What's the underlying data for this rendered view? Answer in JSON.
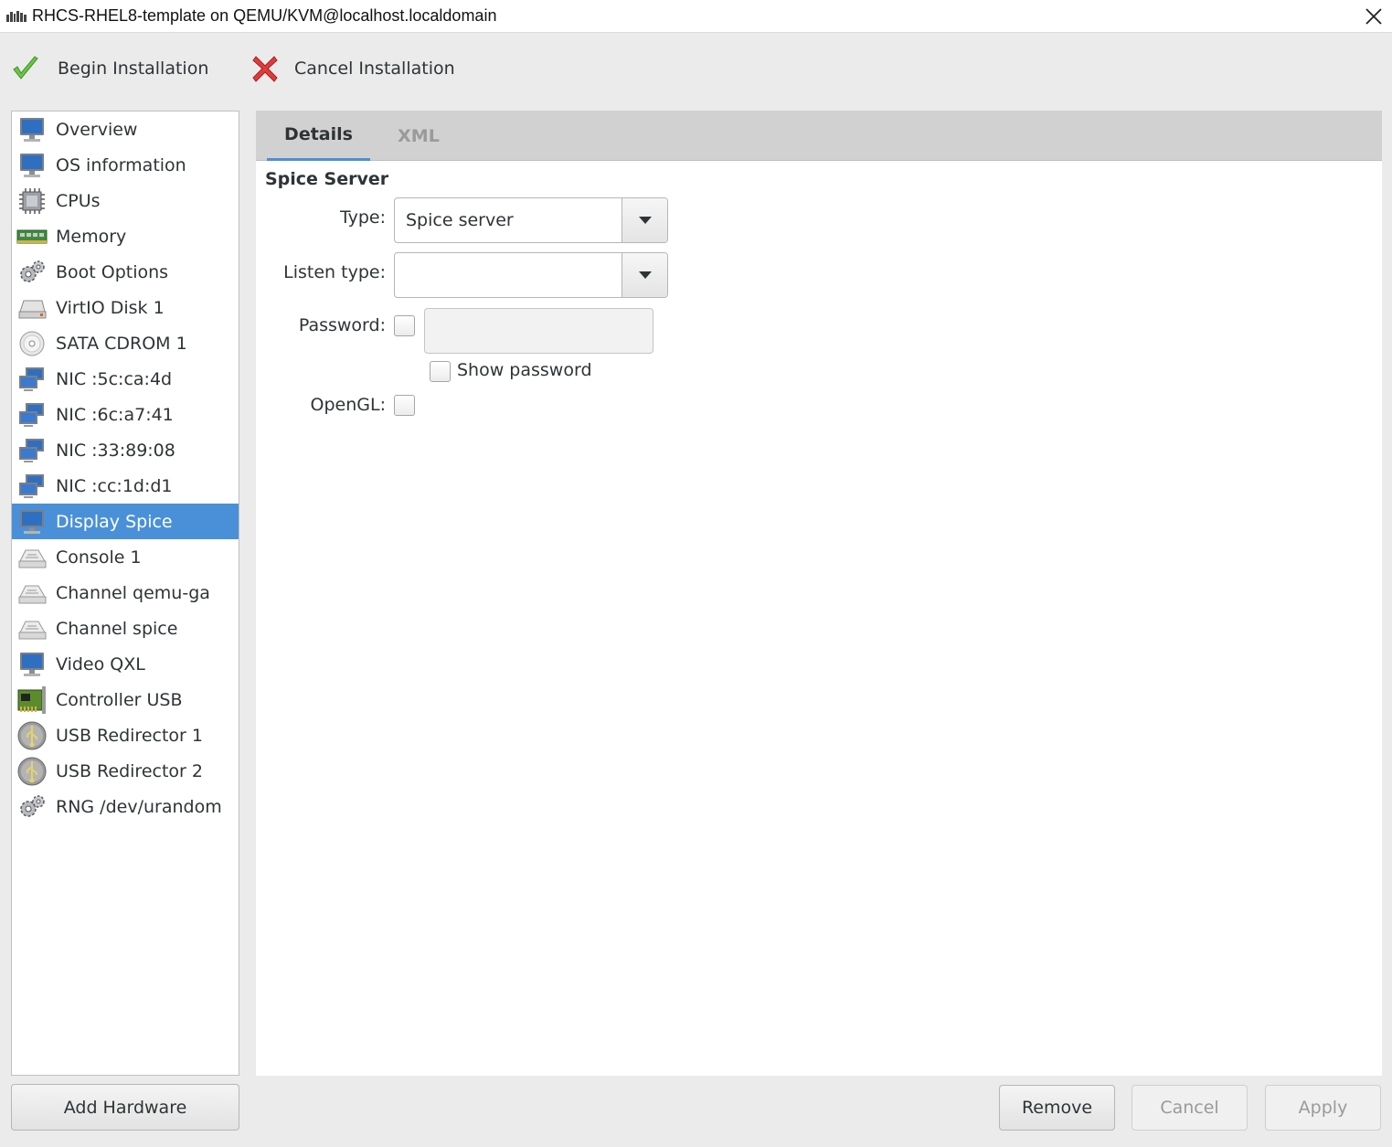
{
  "window": {
    "title": "RHCS-RHEL8-template on QEMU/KVM@localhost.localdomain"
  },
  "toolbar": {
    "begin_label": "Begin Installation",
    "cancel_label": "Cancel Installation"
  },
  "sidebar": {
    "selected_index": 11,
    "items": [
      {
        "label": "Overview",
        "icon": "monitor-icon"
      },
      {
        "label": "OS information",
        "icon": "monitor-icon"
      },
      {
        "label": "CPUs",
        "icon": "cpu-icon"
      },
      {
        "label": "Memory",
        "icon": "memory-icon"
      },
      {
        "label": "Boot Options",
        "icon": "gears-icon"
      },
      {
        "label": "VirtIO Disk 1",
        "icon": "disk-icon"
      },
      {
        "label": "SATA CDROM 1",
        "icon": "cdrom-icon"
      },
      {
        "label": "NIC :5c:ca:4d",
        "icon": "network-icon"
      },
      {
        "label": "NIC :6c:a7:41",
        "icon": "network-icon"
      },
      {
        "label": "NIC :33:89:08",
        "icon": "network-icon"
      },
      {
        "label": "NIC :cc:1d:d1",
        "icon": "network-icon"
      },
      {
        "label": "Display Spice",
        "icon": "monitor-icon"
      },
      {
        "label": "Console 1",
        "icon": "serial-icon"
      },
      {
        "label": "Channel qemu-ga",
        "icon": "serial-icon"
      },
      {
        "label": "Channel spice",
        "icon": "serial-icon"
      },
      {
        "label": "Video QXL",
        "icon": "monitor-icon"
      },
      {
        "label": "Controller USB",
        "icon": "controller-icon"
      },
      {
        "label": "USB Redirector 1",
        "icon": "usb-icon"
      },
      {
        "label": "USB Redirector 2",
        "icon": "usb-icon"
      },
      {
        "label": "RNG /dev/urandom",
        "icon": "gears-icon"
      }
    ],
    "add_hardware_label": "Add Hardware"
  },
  "tabs": {
    "details": "Details",
    "xml": "XML"
  },
  "spice": {
    "section_title": "Spice Server",
    "type_label": "Type:",
    "type_value": "Spice server",
    "listen_label": "Listen type:",
    "listen_value": "",
    "password_label": "Password:",
    "password_checked": false,
    "password_value": "",
    "show_password_label": "Show password",
    "show_password_checked": false,
    "opengl_label": "OpenGL:",
    "opengl_checked": false
  },
  "buttons": {
    "remove": "Remove",
    "cancel": "Cancel",
    "apply": "Apply"
  },
  "colors": {
    "selection": "#4a90d9",
    "begin_check": "#6cc644",
    "cancel_x": "#e23b3b"
  }
}
